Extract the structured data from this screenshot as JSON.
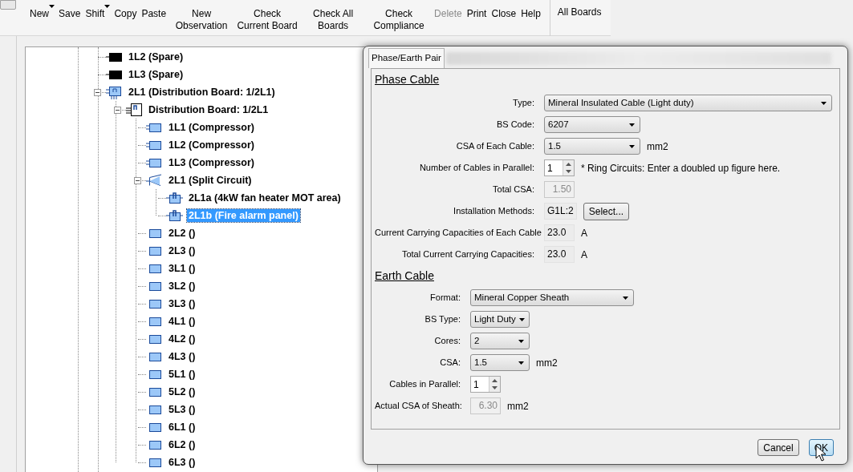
{
  "toolbar": [
    {
      "label": "New",
      "kind": "split",
      "disabled": false
    },
    {
      "label": "Save",
      "kind": "plain",
      "disabled": false
    },
    {
      "label": "Shift",
      "kind": "split",
      "disabled": false
    },
    {
      "label": "Copy",
      "kind": "plain",
      "disabled": false
    },
    {
      "label": "Paste",
      "kind": "plain",
      "disabled": false
    },
    {
      "label": "New Observation",
      "kind": "plain",
      "disabled": false
    },
    {
      "label": "Check Current Board",
      "kind": "plain",
      "disabled": false
    },
    {
      "label": "Check All Boards",
      "kind": "plain",
      "disabled": false
    },
    {
      "label": "Check Compliance",
      "kind": "plain",
      "disabled": false
    },
    {
      "label": "Delete",
      "kind": "plain",
      "disabled": true
    },
    {
      "label": "Print",
      "kind": "plain",
      "disabled": false
    },
    {
      "label": "Close",
      "kind": "plain",
      "disabled": false
    },
    {
      "label": "Help",
      "kind": "plain",
      "disabled": false
    },
    {
      "label": "All Boards",
      "kind": "separated",
      "disabled": false
    }
  ],
  "tree": [
    {
      "label": "1L2 (Spare)",
      "kind": "spare",
      "selected": false
    },
    {
      "label": "1L3 (Spare)",
      "kind": "spare",
      "selected": false
    },
    {
      "label": "2L1 (Distribution Board: 1/2L1)",
      "kind": "board",
      "selected": false,
      "expanded": true,
      "children": [
        {
          "label": "Distribution Board: 1/2L1",
          "kind": "frame",
          "selected": false,
          "expanded": true,
          "children": [
            {
              "label": "1L1 (Compressor)",
              "kind": "circuit",
              "selected": false
            },
            {
              "label": "1L2 (Compressor)",
              "kind": "circuit",
              "selected": false
            },
            {
              "label": "1L3 (Compressor)",
              "kind": "circuit",
              "selected": false
            },
            {
              "label": "2L1 (Split Circuit)",
              "kind": "split",
              "selected": false,
              "expanded": true,
              "children": [
                {
                  "label": "2L1a (4kW fan heater MOT area)",
                  "kind": "sub",
                  "selected": false
                },
                {
                  "label": "2L1b (Fire alarm panel)",
                  "kind": "sub",
                  "selected": true
                }
              ]
            },
            {
              "label": "2L2 ()",
              "kind": "empty",
              "selected": false
            },
            {
              "label": "2L3 ()",
              "kind": "empty",
              "selected": false
            },
            {
              "label": "3L1 ()",
              "kind": "empty",
              "selected": false
            },
            {
              "label": "3L2 ()",
              "kind": "empty",
              "selected": false
            },
            {
              "label": "3L3 ()",
              "kind": "empty",
              "selected": false
            },
            {
              "label": "4L1 ()",
              "kind": "empty",
              "selected": false
            },
            {
              "label": "4L2 ()",
              "kind": "empty",
              "selected": false
            },
            {
              "label": "4L3 ()",
              "kind": "empty",
              "selected": false
            },
            {
              "label": "5L1 ()",
              "kind": "empty",
              "selected": false
            },
            {
              "label": "5L2 ()",
              "kind": "empty",
              "selected": false
            },
            {
              "label": "5L3 ()",
              "kind": "empty",
              "selected": false
            },
            {
              "label": "6L1 ()",
              "kind": "empty",
              "selected": false
            },
            {
              "label": "6L2 ()",
              "kind": "empty",
              "selected": false
            },
            {
              "label": "6L3 ()",
              "kind": "empty",
              "selected": false
            }
          ]
        }
      ]
    }
  ],
  "dialog": {
    "tab": "Phase/Earth Pair",
    "phase_cable": {
      "title": "Phase Cable",
      "fields": [
        {
          "label": "Type:",
          "kind": "long_select",
          "value": "Mineral Insulated Cable (Light duty)"
        },
        {
          "label": "BS Code:",
          "kind": "select",
          "value": "6207"
        },
        {
          "label": "CSA of Each Cable:",
          "kind": "select",
          "value": "1.5",
          "unit": "mm2"
        },
        {
          "label": "Number of Cables in Parallel:",
          "kind": "spinner",
          "value": "1",
          "note": "* Ring Circuits: Enter a doubled up figure here."
        },
        {
          "label": "Total CSA:",
          "kind": "disabled",
          "value": "1.50"
        },
        {
          "label": "Installation Methods:",
          "kind": "picker",
          "value": "G1L:2",
          "button": "Select..."
        },
        {
          "label": "Current Carrying Capacities of Each Cable",
          "kind": "readonly",
          "value": "23.0",
          "unit": "A"
        },
        {
          "label": "Total Current Carrying Capacities:",
          "kind": "readonly",
          "value": "23.0",
          "unit": "A"
        }
      ]
    },
    "earth_cable": {
      "title": "Earth Cable",
      "fields": [
        {
          "label": "Format:",
          "kind": "long_select",
          "value": "Mineral Copper Sheath"
        },
        {
          "label": "BS Type:",
          "kind": "select",
          "value": "Light Duty"
        },
        {
          "label": "Cores:",
          "kind": "select",
          "value": "2"
        },
        {
          "label": "CSA:",
          "kind": "select",
          "value": "1.5",
          "unit": "mm2"
        },
        {
          "label": "Cables in Parallel:",
          "kind": "spinner",
          "value": "1"
        },
        {
          "label": "Actual CSA of Sheath:",
          "kind": "disabled",
          "value": "6.30",
          "unit": "mm2"
        }
      ]
    },
    "buttons": [
      {
        "label": "Cancel",
        "selected": false
      },
      {
        "label": "OK",
        "selected": true
      }
    ]
  }
}
